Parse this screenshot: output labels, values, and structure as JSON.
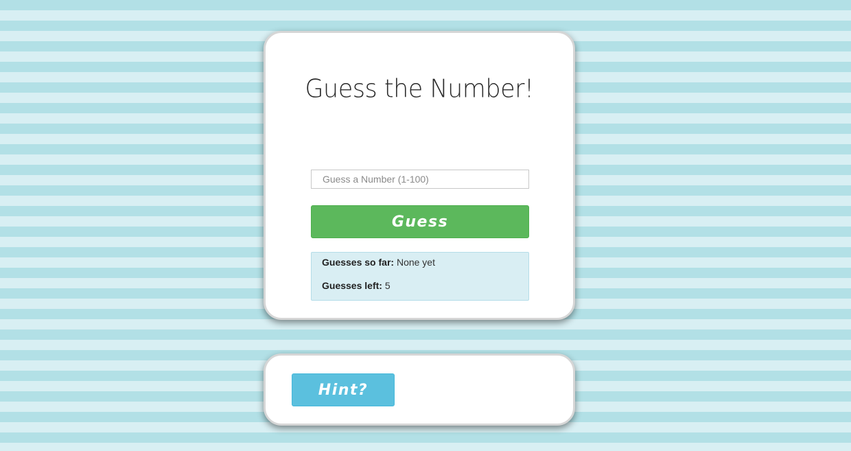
{
  "app": {
    "title": "Guess the Number!"
  },
  "guess_form": {
    "input_value": "",
    "input_placeholder": "Guess a Number (1-100)",
    "guess_button_label": "Guess"
  },
  "status": {
    "guesses_so_far_label": "Guesses so far:",
    "guesses_so_far_value": "None yet",
    "guesses_left_label": "Guesses left:",
    "guesses_left_value": "5"
  },
  "hint": {
    "button_label": "Hint?"
  },
  "colors": {
    "stripe_dark": "#b2e0e6",
    "stripe_light": "#d8eff3",
    "guess_button": "#5cb85c",
    "hint_button": "#5bc0de",
    "status_box": "#d9eef3"
  }
}
